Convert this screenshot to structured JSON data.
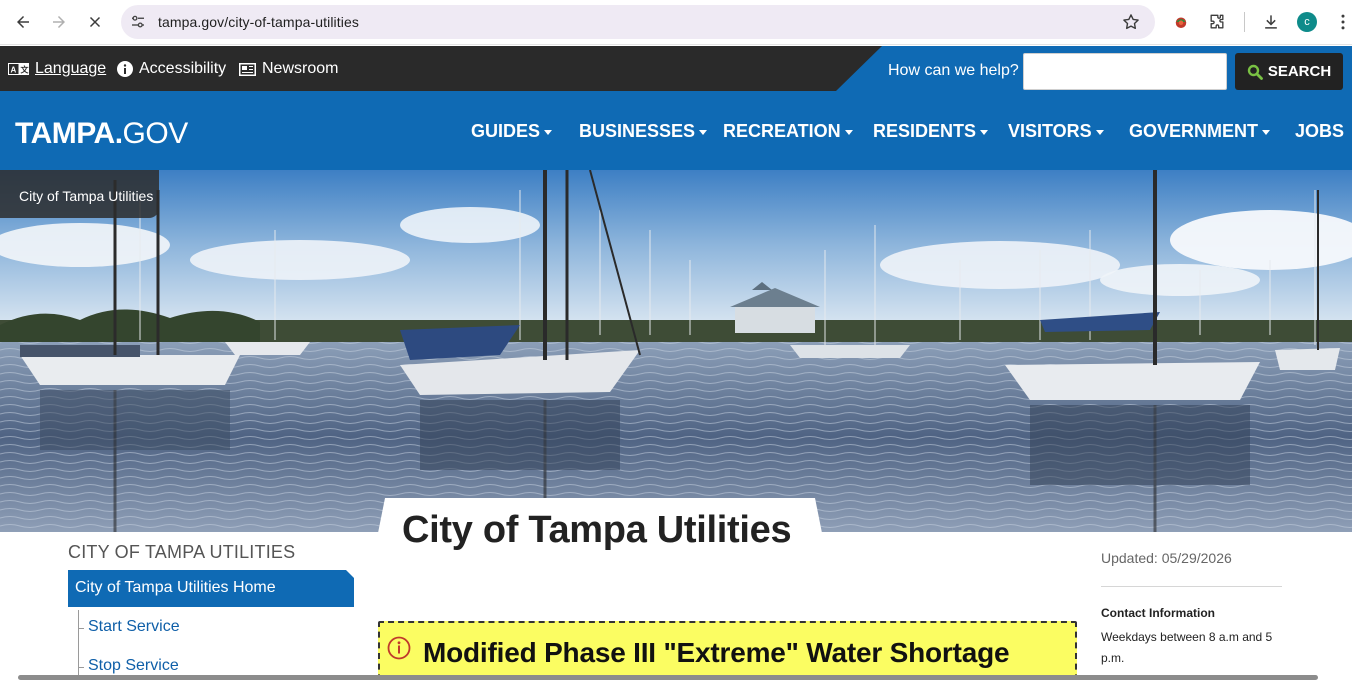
{
  "browser": {
    "url": "tampa.gov/city-of-tampa-utilities",
    "avatar_letter": "c",
    "icons": [
      "back-arrow-icon",
      "forward-arrow-icon",
      "stop-loading-icon",
      "site-settings-icon",
      "bookmark-star-icon",
      "extension-icon",
      "puzzle-icon",
      "download-icon",
      "kebab-menu-icon"
    ]
  },
  "utility_bar": {
    "language": "Language",
    "accessibility": "Accessibility",
    "newsroom": "Newsroom",
    "help_label": "How can we help?",
    "search_value": "",
    "search_button": "SEARCH"
  },
  "nav": {
    "logo_bold": "TAMPA.",
    "logo_light": "GOV",
    "items": [
      {
        "label": "GUIDES",
        "dropdown": true
      },
      {
        "label": "BUSINESSES",
        "dropdown": true
      },
      {
        "label": "RECREATION",
        "dropdown": true
      },
      {
        "label": "RESIDENTS",
        "dropdown": true
      },
      {
        "label": "VISITORS",
        "dropdown": true
      },
      {
        "label": "GOVERNMENT",
        "dropdown": true
      },
      {
        "label": "JOBS",
        "dropdown": false
      }
    ]
  },
  "hero": {
    "breadcrumb": "City of Tampa Utilities"
  },
  "content": {
    "title": "City of Tampa Utilities",
    "sidebar": {
      "heading": "CITY OF TAMPA UTILITIES",
      "active_item": "City of Tampa Utilities Home",
      "sub_items": [
        "Start Service",
        "Stop Service"
      ]
    },
    "alert": {
      "text": "Modified Phase III \"Extreme\" Water Shortage"
    },
    "right": {
      "updated": "Updated: 05/29/2026",
      "contact_heading": "Contact Information",
      "contact_text": "Weekdays between 8 a.m and 5 p.m."
    }
  },
  "colors": {
    "brand_blue": "#0f6ab4",
    "utility_dark": "#2a2a2a",
    "alert_yellow": "#fbfd62"
  }
}
